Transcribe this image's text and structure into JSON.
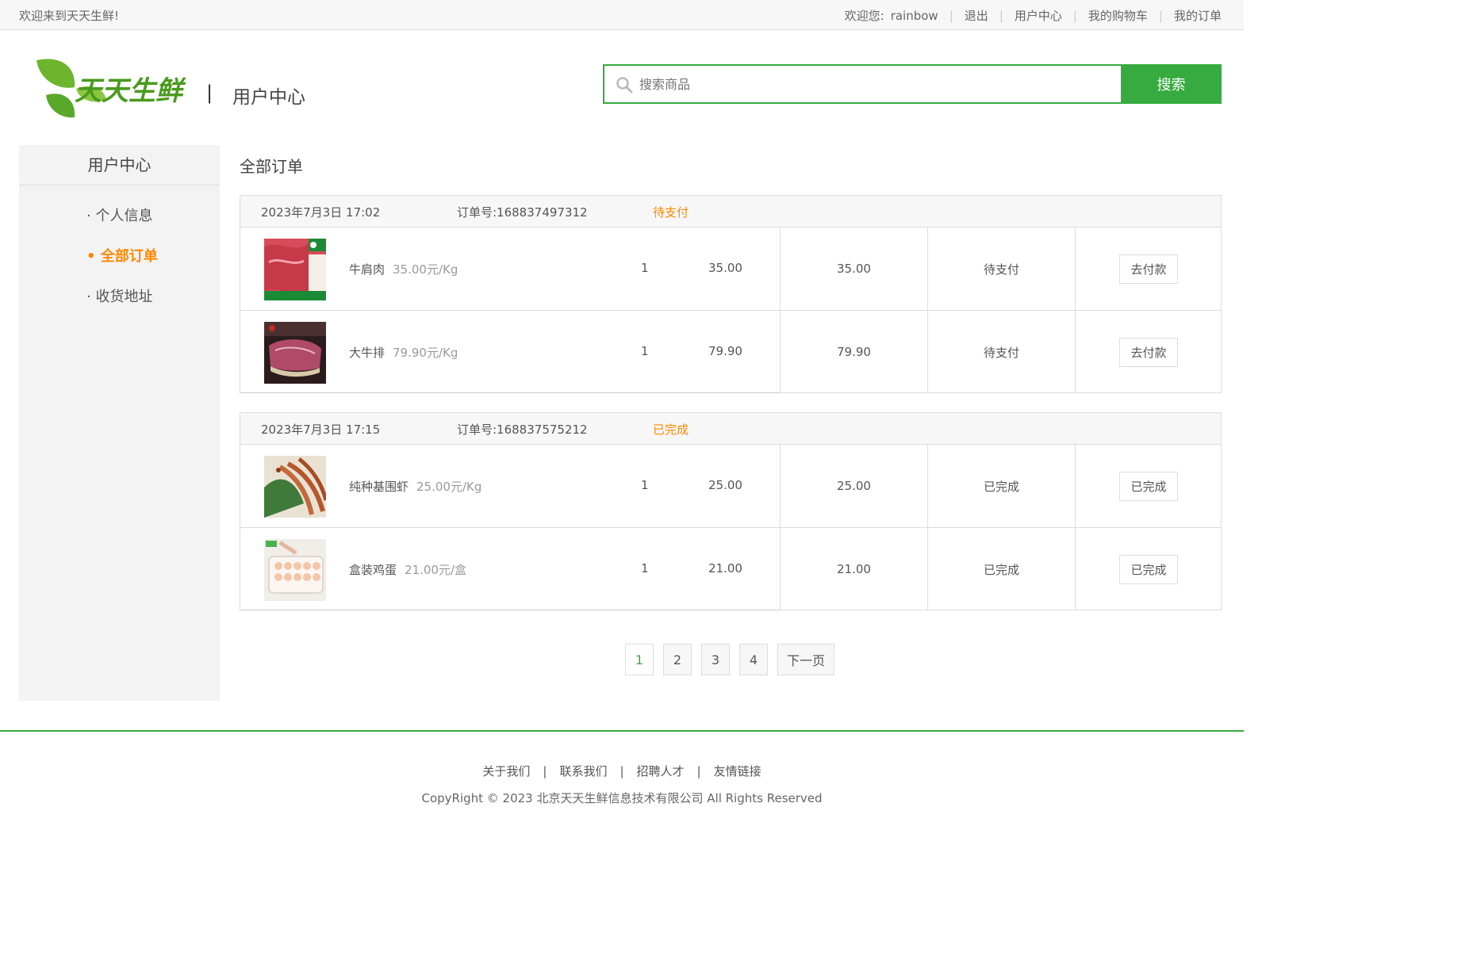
{
  "topbar": {
    "welcome": "欢迎来到天天生鲜!",
    "greeting": "欢迎您:",
    "username": "rainbow",
    "logout": "退出",
    "user_center": "用户中心",
    "cart": "我的购物车",
    "orders": "我的订单"
  },
  "header": {
    "logo_text": "天天生鲜",
    "divider": "|",
    "subtitle": "用户中心",
    "search_placeholder": "搜索商品",
    "search_button": "搜索"
  },
  "sidebar": {
    "title": "用户中心",
    "items": [
      {
        "label": "· 个人信息",
        "active": false
      },
      {
        "label": "• 全部订单",
        "active": true
      },
      {
        "label": "· 收货地址",
        "active": false
      }
    ]
  },
  "main": {
    "title": "全部订单",
    "orders": [
      {
        "date": "2023年7月3日 17:02",
        "order_no": "订单号:168837497312",
        "status": "待支付",
        "items": [
          {
            "name": "牛肩肉",
            "price": "35.00元/Kg",
            "qty": "1",
            "subtotal": "35.00"
          },
          {
            "name": "大牛排",
            "price": "79.90元/Kg",
            "qty": "1",
            "subtotal": "79.90"
          }
        ],
        "totals": [
          "35.00",
          "79.90"
        ],
        "row_status": [
          "待支付",
          "待支付"
        ],
        "actions": [
          "去付款",
          "去付款"
        ]
      },
      {
        "date": "2023年7月3日 17:15",
        "order_no": "订单号:168837575212",
        "status": "已完成",
        "items": [
          {
            "name": "纯种基围虾",
            "price": "25.00元/Kg",
            "qty": "1",
            "subtotal": "25.00"
          },
          {
            "name": "盒装鸡蛋",
            "price": "21.00元/盒",
            "qty": "1",
            "subtotal": "21.00"
          }
        ],
        "totals": [
          "25.00",
          "21.00"
        ],
        "row_status": [
          "已完成",
          "已完成"
        ],
        "actions": [
          "已完成",
          "已完成"
        ]
      }
    ]
  },
  "pagination": {
    "pages": [
      "1",
      "2",
      "3",
      "4"
    ],
    "current": "1",
    "next": "下一页"
  },
  "footer": {
    "links": [
      "关于我们",
      "联系我们",
      "招聘人才",
      "友情链接"
    ],
    "separator": "|",
    "copyright": "CopyRight © 2023 北京天天生鲜信息技术有限公司 All Rights Reserved"
  },
  "colors": {
    "brand_green": "#37ab40",
    "accent_orange": "#ff8800"
  }
}
